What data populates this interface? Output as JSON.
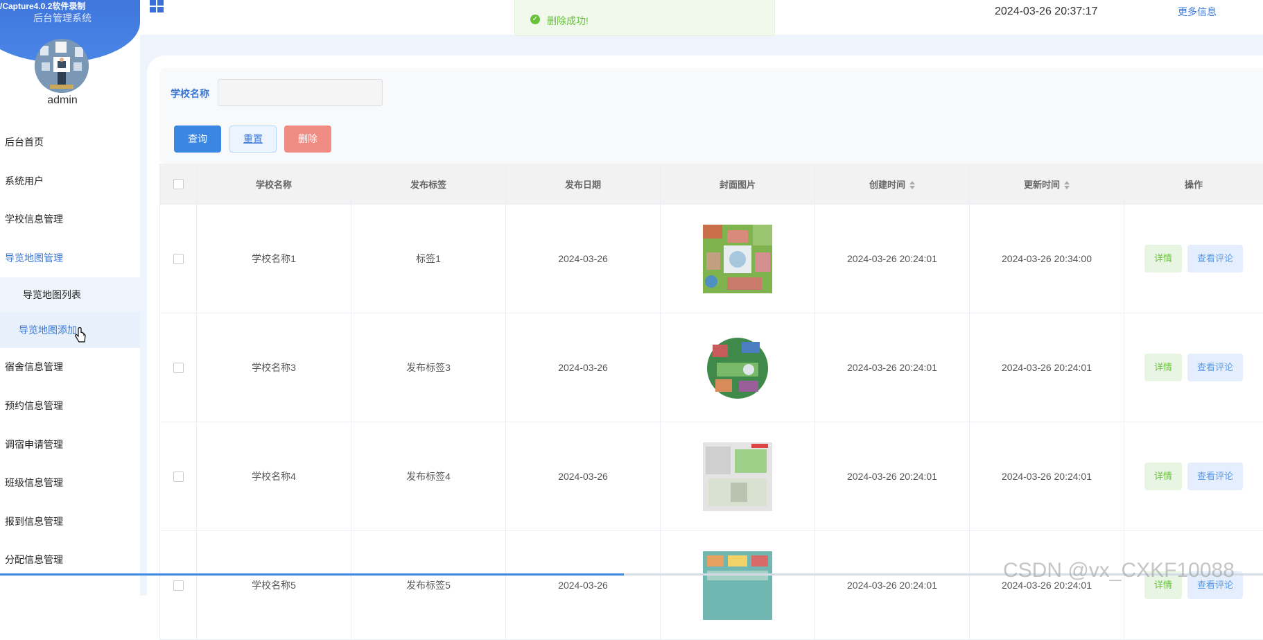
{
  "recorder_title": "/Capture4.0.2软件录制",
  "sidebar": {
    "system_title": "后台管理系统",
    "username": "admin",
    "menu": [
      {
        "label": "后台首页"
      },
      {
        "label": "系统用户"
      },
      {
        "label": "学校信息管理"
      },
      {
        "label": "导览地图管理"
      }
    ],
    "submenu": [
      {
        "label": "导览地图列表"
      },
      {
        "label": "导览地图添加"
      }
    ],
    "menu_after": [
      {
        "label": "宿舍信息管理"
      },
      {
        "label": "预约信息管理"
      },
      {
        "label": "调宿申请管理"
      },
      {
        "label": "班级信息管理"
      },
      {
        "label": "报到信息管理"
      },
      {
        "label": "分配信息管理"
      }
    ]
  },
  "topbar": {
    "datetime": "2024-03-26 20:37:17",
    "more_info": "更多信息"
  },
  "toast": {
    "message": "删除成功!"
  },
  "search": {
    "label": "学校名称",
    "value": "",
    "query_label": "查询",
    "reset_label": "重置",
    "delete_label": "删除"
  },
  "table": {
    "headers": {
      "school_name": "学校名称",
      "tag": "发布标签",
      "publish_date": "发布日期",
      "cover": "封面图片",
      "created": "创建时间",
      "updated": "更新时间",
      "actions": "操作"
    },
    "detail_label": "详情",
    "comments_label": "查看评论",
    "rows": [
      {
        "school_name": "学校名称1",
        "tag": "标签1",
        "publish_date": "2024-03-26",
        "created": "2024-03-26 20:24:01",
        "updated": "2024-03-26 20:34:00"
      },
      {
        "school_name": "学校名称3",
        "tag": "发布标签3",
        "publish_date": "2024-03-26",
        "created": "2024-03-26 20:24:01",
        "updated": "2024-03-26 20:24:01"
      },
      {
        "school_name": "学校名称4",
        "tag": "发布标签4",
        "publish_date": "2024-03-26",
        "created": "2024-03-26 20:24:01",
        "updated": "2024-03-26 20:24:01"
      },
      {
        "school_name": "学校名称5",
        "tag": "发布标签5",
        "publish_date": "2024-03-26",
        "created": "2024-03-26 20:24:01",
        "updated": "2024-03-26 20:24:01"
      }
    ]
  },
  "watermark": "CSDN @vx_CXKF10088",
  "colors": {
    "primary": "#3a86e0",
    "success": "#67c23a",
    "danger": "#f08c84",
    "sidebar_header": "#3a6fd8"
  }
}
